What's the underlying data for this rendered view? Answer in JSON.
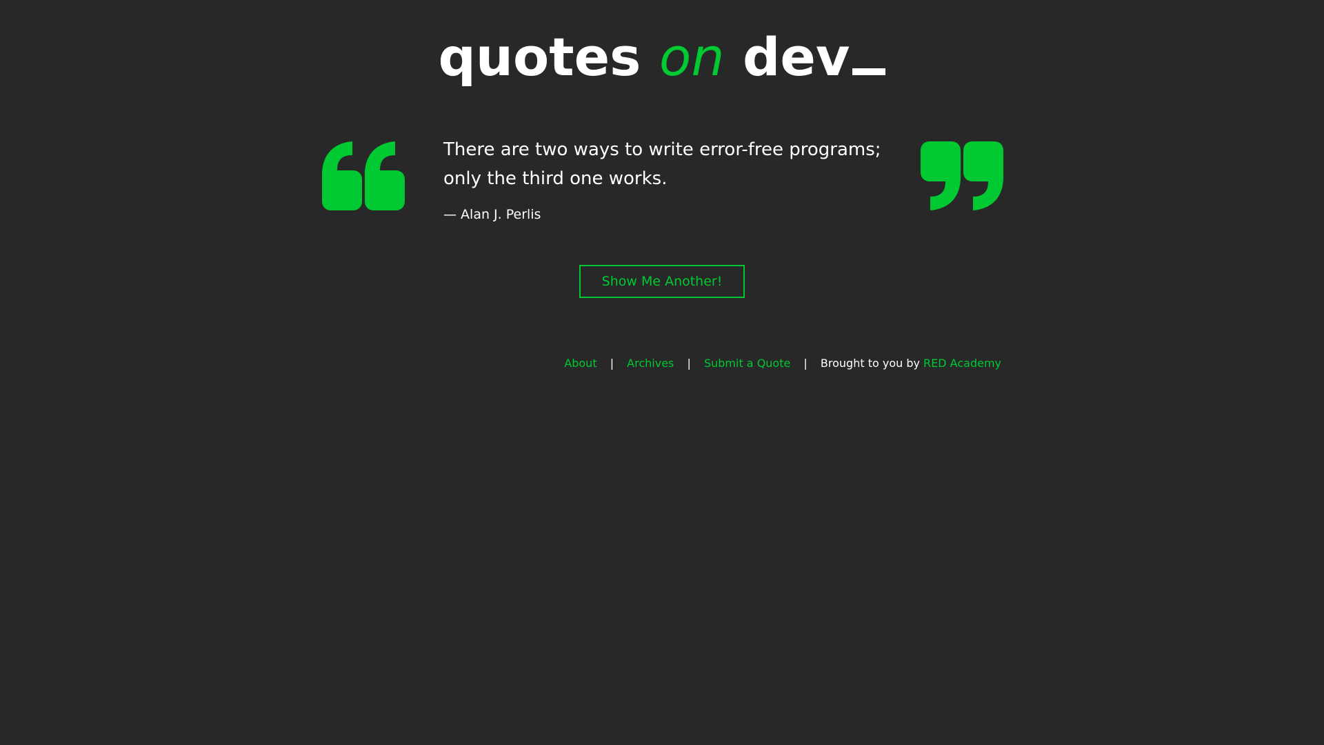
{
  "header": {
    "logo_part1": "quotes",
    "logo_part2": "on",
    "logo_part3": "dev"
  },
  "quote": {
    "text": "There are two ways to write error-free programs; only the third one works.",
    "author": "— Alan J. Perlis",
    "open_icon": "open-quote-icon",
    "close_icon": "close-quote-icon"
  },
  "actions": {
    "another_label": "Show Me Another!"
  },
  "footer": {
    "about": "About",
    "archives": "Archives",
    "submit": "Submit a Quote",
    "separator": "|",
    "brought_by": "Brought to you by",
    "sponsor": "RED Academy"
  },
  "colors": {
    "background": "#282828",
    "accent": "#00c932",
    "text": "#ffffff"
  }
}
